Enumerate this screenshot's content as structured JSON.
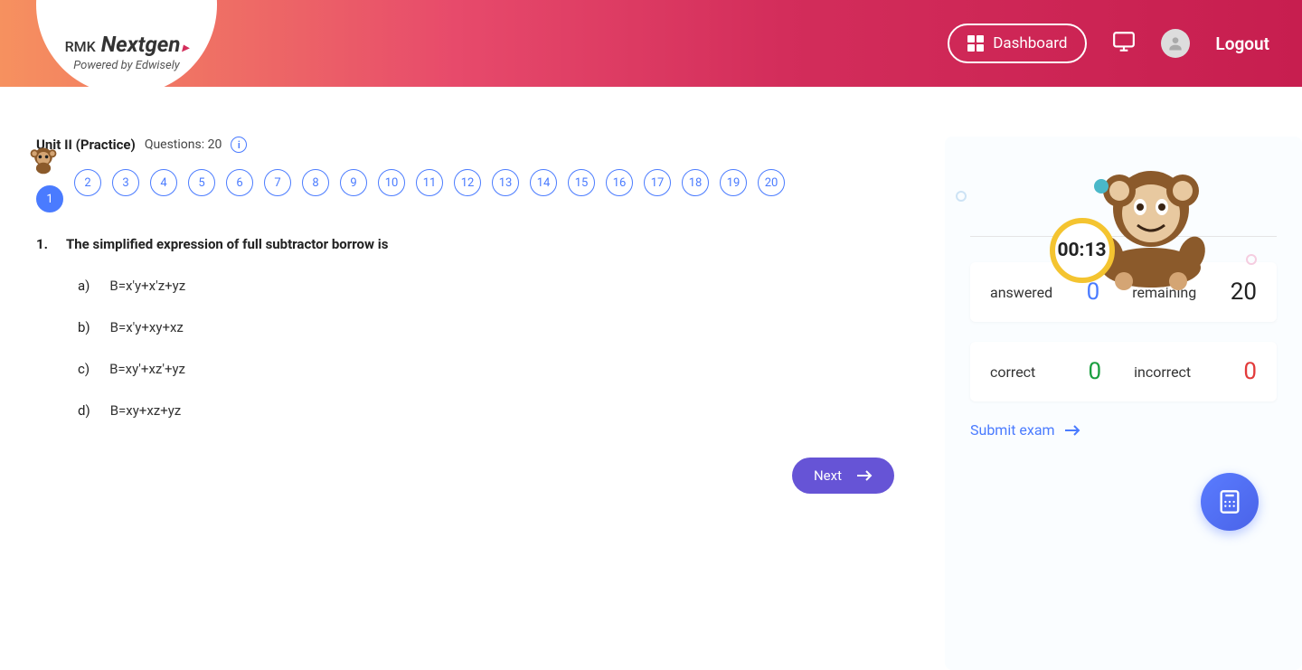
{
  "header": {
    "logo": {
      "primary": "RMK",
      "secondary": "Nextgen",
      "tagline": "Powered by Edwisely"
    },
    "dashboard_label": "Dashboard",
    "logout_label": "Logout"
  },
  "quiz": {
    "title": "Unit II (Practice)",
    "meta": "Questions: 20",
    "nav": [
      "1",
      "2",
      "3",
      "4",
      "5",
      "6",
      "7",
      "8",
      "9",
      "10",
      "11",
      "12",
      "13",
      "14",
      "15",
      "16",
      "17",
      "18",
      "19",
      "20"
    ],
    "active_index": 0,
    "question": {
      "number": "1.",
      "text": "The simplified expression of full subtractor borrow is",
      "options": [
        {
          "key": "a)",
          "text": "B=x'y+x'z+yz"
        },
        {
          "key": "b)",
          "text": "B=x'y+xy+xz"
        },
        {
          "key": "c)",
          "text": "B=xy'+xz'+yz"
        },
        {
          "key": "d)",
          "text": "B=xy+xz+yz"
        }
      ]
    },
    "next_label": "Next"
  },
  "side": {
    "timer": "00:13",
    "stats": {
      "answered_label": "answered",
      "answered_value": "0",
      "remaining_label": "remaining",
      "remaining_value": "20",
      "correct_label": "correct",
      "correct_value": "0",
      "incorrect_label": "incorrect",
      "incorrect_value": "0"
    },
    "submit_label": "Submit exam"
  }
}
